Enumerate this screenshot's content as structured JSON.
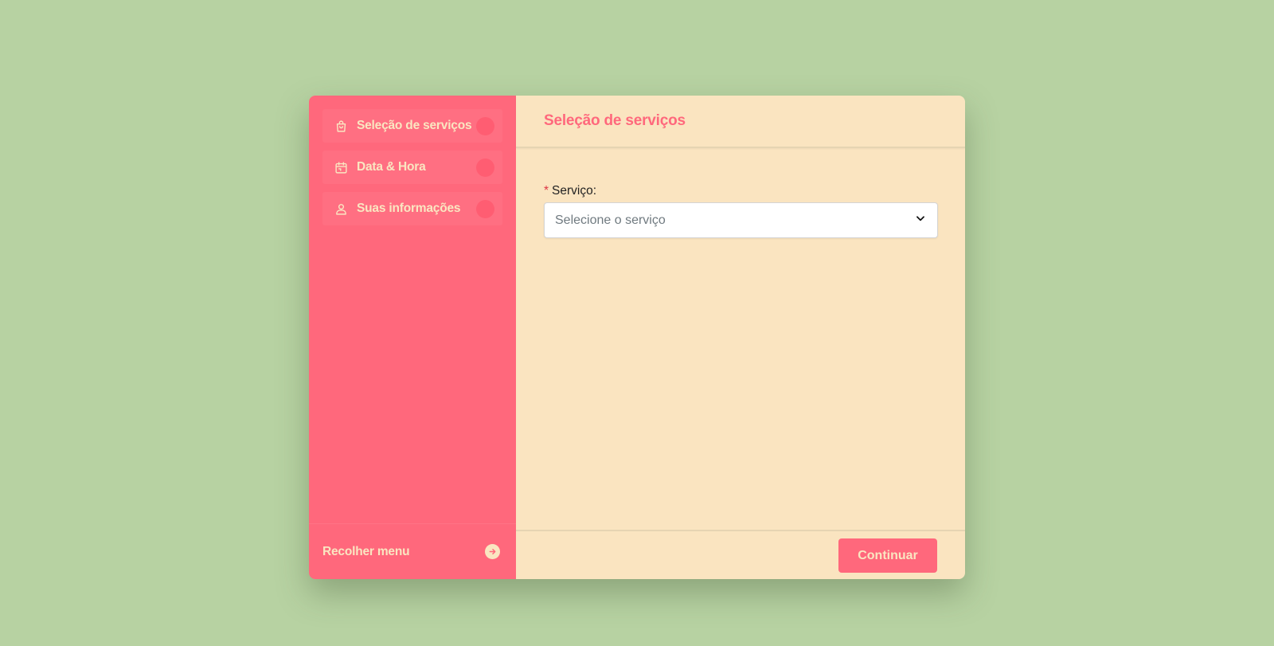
{
  "sidebar": {
    "steps": [
      {
        "label": "Seleção de serviços",
        "icon": "shopping-bag-icon"
      },
      {
        "label": "Data & Hora",
        "icon": "calendar-icon"
      },
      {
        "label": "Suas informações",
        "icon": "user-icon"
      }
    ],
    "collapse_label": "Recolher menu",
    "collapse_icon": "arrow-right-circle-icon"
  },
  "main": {
    "title": "Seleção de serviços",
    "service_field": {
      "required_mark": "*",
      "label": "Serviço:",
      "placeholder": "Selecione o serviço"
    },
    "continue_label": "Continuar"
  },
  "colors": {
    "background": "#b7d2a2",
    "sidebar": "#ff687c",
    "panel": "#fae4c0",
    "accent": "#ff687c",
    "text_light": "#fae6c1"
  }
}
